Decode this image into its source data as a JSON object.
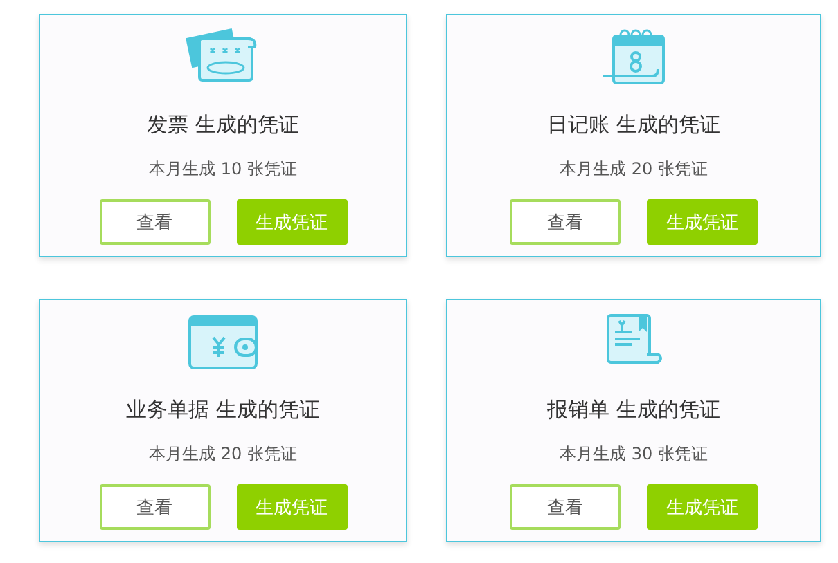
{
  "cards": [
    {
      "kind": "invoice",
      "title": "发票 生成的凭证",
      "summary": "本月生成 10 张凭证",
      "view_button": "查看",
      "generate_button": "生成凭证"
    },
    {
      "kind": "calendar",
      "title": "日记账 生成的凭证",
      "summary": "本月生成 20 张凭证",
      "view_button": "查看",
      "generate_button": "生成凭证"
    },
    {
      "kind": "wallet",
      "title": "业务单据 生成的凭证",
      "summary": "本月生成 20 张凭证",
      "view_button": "查看",
      "generate_button": "生成凭证"
    },
    {
      "kind": "receipt",
      "title": "报销单 生成的凭证",
      "summary": "本月生成 30 张凭证",
      "view_button": "查看",
      "generate_button": "生成凭证"
    }
  ]
}
